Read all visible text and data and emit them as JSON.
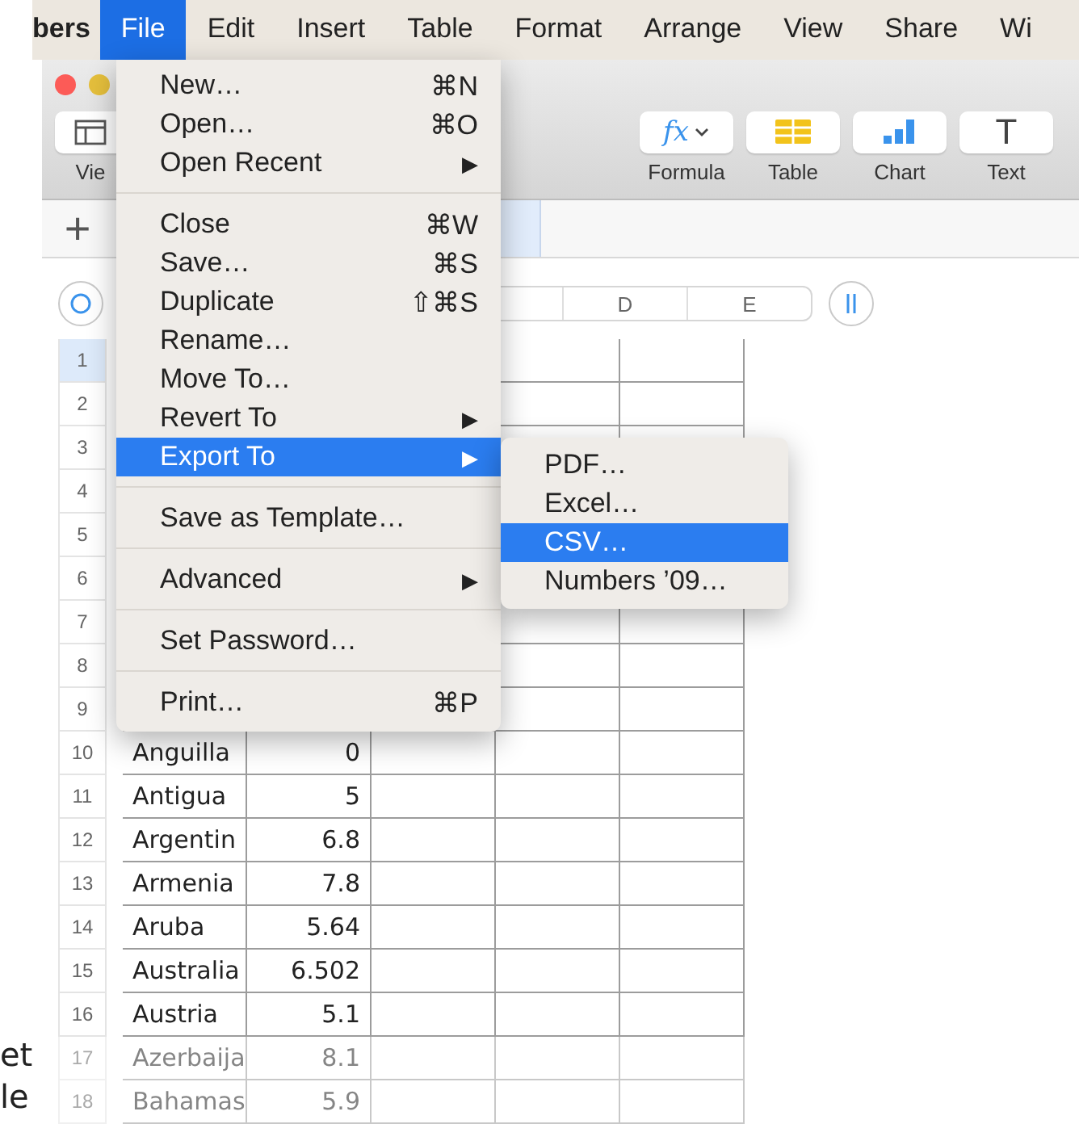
{
  "menubar": [
    {
      "label": "bers",
      "selected": false
    },
    {
      "label": "File",
      "selected": true
    },
    {
      "label": "Edit",
      "selected": false
    },
    {
      "label": "Insert",
      "selected": false
    },
    {
      "label": "Table",
      "selected": false
    },
    {
      "label": "Format",
      "selected": false
    },
    {
      "label": "Arrange",
      "selected": false
    },
    {
      "label": "View",
      "selected": false
    },
    {
      "label": "Share",
      "selected": false
    },
    {
      "label": "Wi",
      "selected": false
    }
  ],
  "toolbar": {
    "view_label": "Vie",
    "buttons": [
      {
        "kind": "formula",
        "label": "Formula",
        "glyph": "fx"
      },
      {
        "kind": "table",
        "label": "Table"
      },
      {
        "kind": "chart",
        "label": "Chart"
      },
      {
        "kind": "text",
        "label": "Text",
        "glyph": "T"
      }
    ]
  },
  "tabbar": {
    "add": "+"
  },
  "sheet": {
    "column_headers": [
      "D",
      "E"
    ],
    "rows": [
      {
        "number": "1",
        "selected": true,
        "faded": false
      },
      {
        "number": "2",
        "selected": false,
        "faded": false
      },
      {
        "number": "3",
        "selected": false,
        "faded": false
      },
      {
        "number": "4",
        "selected": false,
        "faded": false
      },
      {
        "number": "5",
        "selected": false,
        "faded": false
      },
      {
        "number": "6",
        "selected": false,
        "faded": false
      },
      {
        "number": "7",
        "selected": false,
        "faded": false
      },
      {
        "number": "8",
        "selected": false,
        "faded": false
      },
      {
        "number": "9",
        "selected": false,
        "faded": false
      },
      {
        "number": "10",
        "selected": false,
        "faded": false,
        "cells": [
          "Anguilla",
          "0"
        ]
      },
      {
        "number": "11",
        "selected": false,
        "faded": false,
        "cells": [
          "Antigua",
          "5"
        ]
      },
      {
        "number": "12",
        "selected": false,
        "faded": false,
        "cells": [
          "Argentin",
          "6.8"
        ]
      },
      {
        "number": "13",
        "selected": false,
        "faded": false,
        "cells": [
          "Armenia",
          "7.8"
        ]
      },
      {
        "number": "14",
        "selected": false,
        "faded": false,
        "cells": [
          "Aruba",
          "5.64"
        ]
      },
      {
        "number": "15",
        "selected": false,
        "faded": false,
        "cells": [
          "Australia",
          "6.502"
        ]
      },
      {
        "number": "16",
        "selected": false,
        "faded": false,
        "cells": [
          "Austria",
          "5.1"
        ]
      },
      {
        "number": "17",
        "selected": false,
        "faded": true,
        "cells": [
          "Azerbaija",
          "8.1"
        ]
      },
      {
        "number": "18",
        "selected": false,
        "faded": true,
        "cells": [
          "Bahamas",
          "5.9"
        ]
      }
    ]
  },
  "side_text": [
    "et",
    "le"
  ],
  "file_menu": {
    "sections": [
      [
        {
          "label": "New…",
          "shortcut": "⌘N",
          "submenu": false,
          "selected": false
        },
        {
          "label": "Open…",
          "shortcut": "⌘O",
          "submenu": false,
          "selected": false
        },
        {
          "label": "Open Recent",
          "submenu": true,
          "selected": false
        }
      ],
      [
        {
          "label": "Close",
          "shortcut": "⌘W",
          "submenu": false,
          "selected": false
        },
        {
          "label": "Save…",
          "shortcut": "⌘S",
          "submenu": false,
          "selected": false
        },
        {
          "label": "Duplicate",
          "shortcut": "⇧⌘S",
          "submenu": false,
          "selected": false
        },
        {
          "label": "Rename…",
          "submenu": false,
          "selected": false
        },
        {
          "label": "Move To…",
          "submenu": false,
          "selected": false
        },
        {
          "label": "Revert To",
          "submenu": true,
          "selected": false
        },
        {
          "label": "Export To",
          "submenu": true,
          "selected": true
        }
      ],
      [
        {
          "label": "Save as Template…",
          "submenu": false,
          "selected": false
        }
      ],
      [
        {
          "label": "Advanced",
          "submenu": true,
          "selected": false
        }
      ],
      [
        {
          "label": "Set Password…",
          "submenu": false,
          "selected": false
        }
      ],
      [
        {
          "label": "Print…",
          "shortcut": "⌘P",
          "submenu": false,
          "selected": false
        }
      ]
    ],
    "submenu_arrow": "▶"
  },
  "export_submenu": [
    {
      "label": "PDF…",
      "selected": false
    },
    {
      "label": "Excel…",
      "selected": false
    },
    {
      "label": "CSV…",
      "selected": true
    },
    {
      "label": "Numbers ’09…",
      "selected": false
    }
  ]
}
